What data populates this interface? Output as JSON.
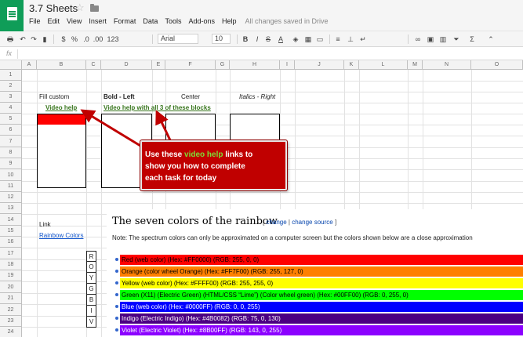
{
  "app": {
    "title": "3.7 Sheets",
    "menu": [
      "File",
      "Edit",
      "View",
      "Insert",
      "Format",
      "Data",
      "Tools",
      "Add-ons",
      "Help"
    ],
    "save_status": "All changes saved in Drive"
  },
  "toolbar": {
    "percent": "%",
    "decimal_decrease": ".0",
    "decimal_increase": ".00",
    "more_formats": "123",
    "font": "Arial",
    "font_size": "10",
    "bold": "B",
    "italic": "I",
    "strike": "S",
    "text_color": "A"
  },
  "formula_bar": {
    "fx_label": "fx"
  },
  "columns": [
    "A",
    "B",
    "C",
    "D",
    "E",
    "F",
    "G",
    "H",
    "I",
    "J",
    "K",
    "L",
    "M",
    "N",
    "O"
  ],
  "rows": [
    "1",
    "2",
    "3",
    "4",
    "5",
    "6",
    "7",
    "8",
    "9",
    "10",
    "11",
    "12",
    "13",
    "14",
    "15",
    "16",
    "17",
    "18",
    "19",
    "20",
    "21",
    "22",
    "23",
    "24"
  ],
  "cells": {
    "fill_custom": "Fill custom",
    "bold_left": "Bold - Left",
    "center": "Center",
    "italics_right": "Italics - Right",
    "video_help": "Video help",
    "video_help_all": "Video help with all 3 of these blocks",
    "link_label": "Link",
    "rainbow_colors": "Rainbow Colors",
    "roygbiv": [
      "R",
      "O",
      "Y",
      "G",
      "B",
      "I",
      "V"
    ]
  },
  "callout": {
    "line1_pre": "Use these ",
    "line1_green": "video help",
    "line1_post": " links to",
    "line2": "show you how to complete",
    "line3": "each task for today",
    "color": "#c00000"
  },
  "rainbow": {
    "title": "The seven colors of the rainbow",
    "change_open": "[ ",
    "change": "change",
    "change_sep": " | ",
    "change_source": "change source",
    "change_close": " ]",
    "note": "Note: The spectrum colors can only be approximated on a computer screen but the colors shown below are a close approximation",
    "bars": [
      {
        "label": "Red (web color) (Hex: #FF0000) (RGB: 255, 0, 0)",
        "bg": "#FF0000",
        "fg": "#000000"
      },
      {
        "label": "Orange (color wheel Orange) (Hex: #FF7F00) (RGB: 255, 127, 0)",
        "bg": "#FF7F00",
        "fg": "#000000"
      },
      {
        "label": "Yellow (web color) (Hex: #FFFF00) (RGB: 255, 255, 0)",
        "bg": "#FFFF00",
        "fg": "#000000"
      },
      {
        "label": "Green (X11) (Electric Green) (HTML/CSS “Lime”) (Color wheel green) (Hex: #00FF00) (RGB: 0, 255, 0)",
        "bg": "#00FF00",
        "fg": "#000000"
      },
      {
        "label": "Blue (web color) (Hex: #0000FF) (RGB: 0, 0, 255)",
        "bg": "#0000FF",
        "fg": "#ffffff"
      },
      {
        "label": "Indigo (Electric Indigo) (Hex: #4B0082) (RGB: 75, 0, 130)",
        "bg": "#4B0082",
        "fg": "#ffffff"
      },
      {
        "label": "Violet (Electric Violet) (Hex: #8B00FF) (RGB: 143, 0, 255)",
        "bg": "#8B00FF",
        "fg": "#ffffff"
      }
    ]
  }
}
